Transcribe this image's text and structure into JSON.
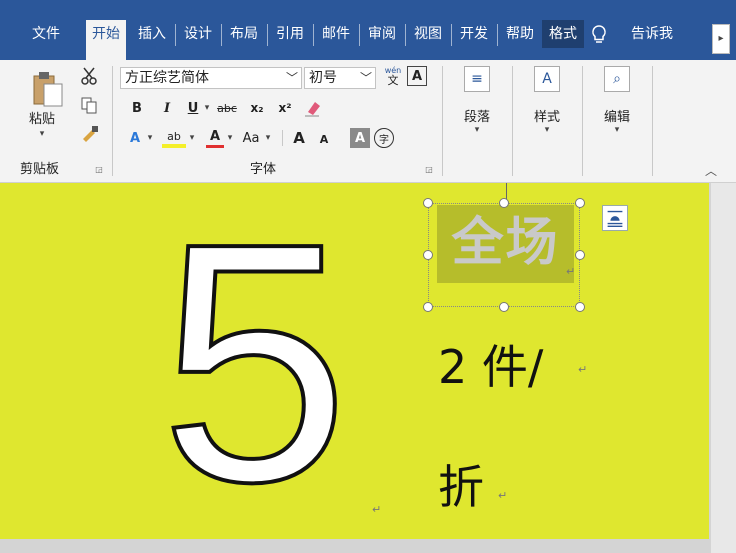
{
  "tabs": [
    {
      "label": "文件"
    },
    {
      "label": "开始"
    },
    {
      "label": "插入"
    },
    {
      "label": "设计"
    },
    {
      "label": "布局"
    },
    {
      "label": "引用"
    },
    {
      "label": "邮件"
    },
    {
      "label": "审阅"
    },
    {
      "label": "视图"
    },
    {
      "label": "开发"
    },
    {
      "label": "帮助"
    },
    {
      "label": "格式"
    }
  ],
  "tell_me": "告诉我",
  "clipboard": {
    "paste_label": "粘贴",
    "group_label": "剪贴板"
  },
  "font": {
    "name": "方正综艺简体",
    "size": "初号",
    "bold": "B",
    "italic": "I",
    "underline": "U",
    "strike": "abc",
    "subscript": "x₂",
    "superscript": "x²",
    "font_color": "A",
    "change_case": "Aa",
    "grow": "A",
    "shrink": "A",
    "shading": "A",
    "enclose": "字",
    "phonetic_top": "wén",
    "phonetic_bottom": "文",
    "border_char": "A",
    "group_label": "字体"
  },
  "paragraph": {
    "label": "段落"
  },
  "styles": {
    "label": "样式"
  },
  "editing": {
    "label": "编辑"
  },
  "document": {
    "big_number": "5",
    "shape_text": "全场",
    "line1": "2 件/",
    "line2": "折"
  },
  "colors": {
    "ribbon_blue": "#2b579a",
    "page_yellow": "#dfe72f",
    "shape_fill": "#b6bd2b"
  }
}
